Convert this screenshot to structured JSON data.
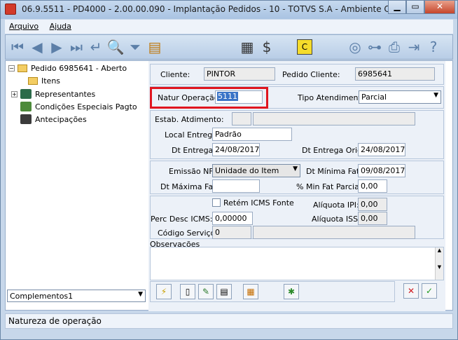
{
  "window": {
    "title": "06.9.5511 - PD4000 - 2.00.00.090 - Implantação Pedidos - 10 - TOTVS S.A - Ambiente Corporat..."
  },
  "menu": {
    "file": "Arquivo",
    "help": "Ajuda"
  },
  "tree": {
    "order": "Pedido 6985641 - Aberto",
    "items": "Itens",
    "reps": "Representantes",
    "conditions": "Condições Especiais Pagto",
    "advances": "Antecipações"
  },
  "left_combo": {
    "value": "Complementos1"
  },
  "form": {
    "client_label": "Cliente:",
    "client_value": "PINTOR",
    "client_order_label": "Pedido Cliente:",
    "client_order_value": "6985641",
    "natur_label": "Natur Operação:",
    "natur_value": "5111",
    "service_type_label": "Tipo Atendimento:",
    "service_type_value": "Parcial",
    "estab_label": "Estab. Atdimento:",
    "delivery_place_label": "Local Entrega:",
    "delivery_place_value": "Padrão",
    "delivery_date_label": "Dt Entrega:",
    "delivery_date_value": "24/08/2017",
    "orig_date_label": "Dt Entrega Orig:",
    "orig_date_value": "24/08/2017",
    "nf_label": "Emissão NF:",
    "nf_value": "Unidade do Item",
    "min_date_label": "Dt Mínima Fat:",
    "min_date_value": "09/08/2017",
    "max_date_label": "Dt Máxima Fat:",
    "max_date_value": "",
    "min_partial_label": "% Min Fat Parcial:",
    "min_partial_value": "0,00",
    "retain_label": "Retém ICMS Fonte",
    "ipi_label": "Alíquota IPI:",
    "ipi_value": "0,00",
    "discount_label": "Perc Desc ICMS:",
    "discount_value": "0,00000",
    "iss_label": "Alíquota ISS:",
    "iss_value": "0,00",
    "service_code_label": "Código Serviço:",
    "service_code_value": "0",
    "obs_label": "Observações"
  },
  "status": {
    "text": "Natureza de operação"
  }
}
